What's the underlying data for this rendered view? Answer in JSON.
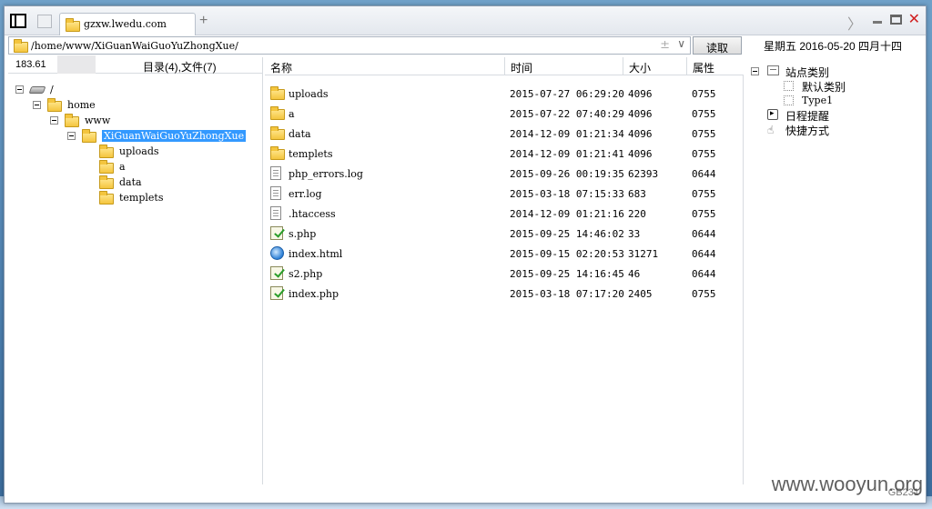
{
  "window": {
    "tab_title": "gzxw.lwedu.com",
    "tab_add": "+",
    "close_glyph": "✕",
    "chevron_glyph": "〉"
  },
  "address": {
    "path": "/home/www/XiGuanWaiGuoYuZhongXue/",
    "plus_glyph": "±",
    "dropdown_glyph": "∨",
    "read_button": "读取"
  },
  "date_display": "星期五  2016-05-20  四月十四",
  "left_header": {
    "ip": "183.61",
    "counts": "目录(4),文件(7)"
  },
  "tree": [
    {
      "label": "/",
      "depth": 0,
      "type": "drive"
    },
    {
      "label": "home",
      "depth": 1,
      "type": "folder"
    },
    {
      "label": "www",
      "depth": 2,
      "type": "folder"
    },
    {
      "label": "XiGuanWaiGuoYuZhongXue",
      "depth": 3,
      "type": "folder",
      "selected": true
    },
    {
      "label": "uploads",
      "depth": 4,
      "type": "folder"
    },
    {
      "label": "a",
      "depth": 4,
      "type": "folder"
    },
    {
      "label": "data",
      "depth": 4,
      "type": "folder"
    },
    {
      "label": "templets",
      "depth": 4,
      "type": "folder"
    }
  ],
  "columns": {
    "name": "名称",
    "time": "时间",
    "size": "大小",
    "perm": "属性"
  },
  "files": [
    {
      "name": "uploads",
      "time": "2015-07-27 06:29:20",
      "size": "4096",
      "perm": "0755",
      "icon": "folder"
    },
    {
      "name": "a",
      "time": "2015-07-22 07:40:29",
      "size": "4096",
      "perm": "0755",
      "icon": "folder"
    },
    {
      "name": "data",
      "time": "2014-12-09 01:21:34",
      "size": "4096",
      "perm": "0755",
      "icon": "folder"
    },
    {
      "name": "templets",
      "time": "2014-12-09 01:21:41",
      "size": "4096",
      "perm": "0755",
      "icon": "folder"
    },
    {
      "name": "php_errors.log",
      "time": "2015-09-26 00:19:35",
      "size": "62393",
      "perm": "0644",
      "icon": "doc"
    },
    {
      "name": "err.log",
      "time": "2015-03-18 07:15:33",
      "size": "683",
      "perm": "0755",
      "icon": "doc"
    },
    {
      "name": ".htaccess",
      "time": "2014-12-09 01:21:16",
      "size": "220",
      "perm": "0755",
      "icon": "doc"
    },
    {
      "name": "s.php",
      "time": "2015-09-25 14:46:02",
      "size": "33",
      "perm": "0644",
      "icon": "php"
    },
    {
      "name": "index.html",
      "time": "2015-09-15 02:20:53",
      "size": "31271",
      "perm": "0644",
      "icon": "html"
    },
    {
      "name": "s2.php",
      "time": "2015-09-25 14:16:45",
      "size": "46",
      "perm": "0644",
      "icon": "php"
    },
    {
      "name": "index.php",
      "time": "2015-03-18 07:17:20",
      "size": "2405",
      "perm": "0755",
      "icon": "php"
    }
  ],
  "right_tree": {
    "site_category": "站点类别",
    "default_category": "默认类别",
    "type1": "Type1",
    "schedule": "日程提醒",
    "shortcuts": "快捷方式"
  },
  "overlay": {
    "watermark": "www.wooyun.org",
    "gb_tag": "GB231"
  }
}
